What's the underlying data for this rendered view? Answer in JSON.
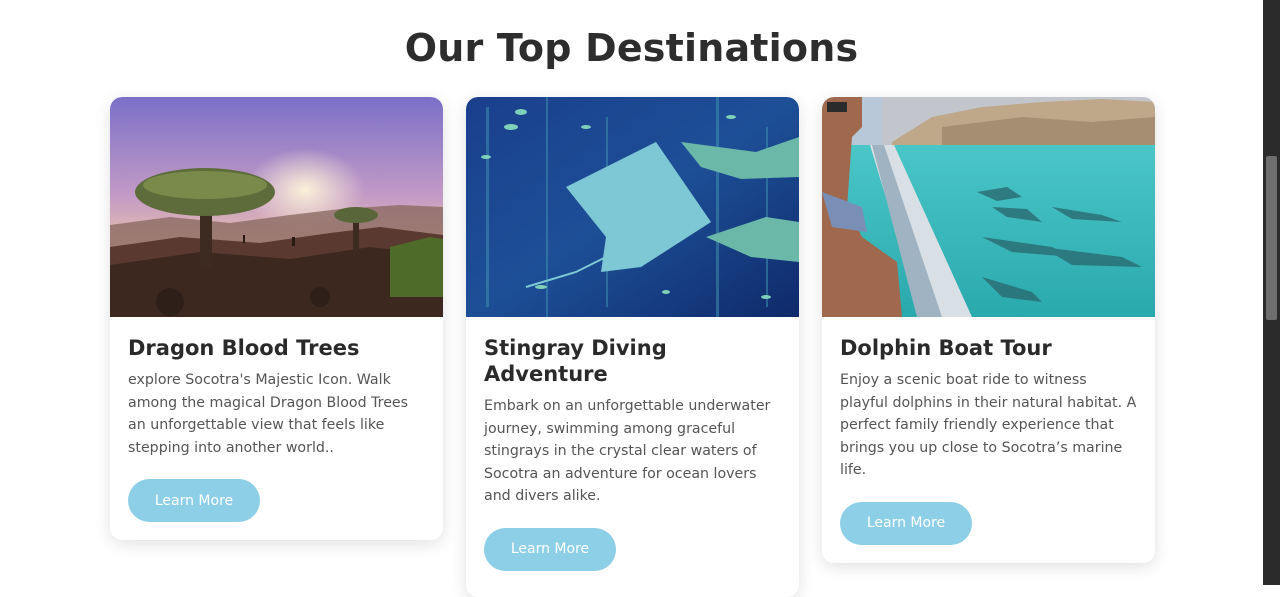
{
  "section": {
    "title": "Our Top Destinations"
  },
  "cards": [
    {
      "title": "Dragon Blood Trees",
      "description": "explore Socotra's Majestic Icon. Walk among the magical Dragon Blood Trees an unforgettable view that feels like stepping into another world..",
      "button_label": "Learn More",
      "image": "dragon-blood-trees-photo"
    },
    {
      "title": "Stingray Diving Adventure",
      "description": "Embark on an unforgettable underwater journey, swimming among graceful stingrays in the crystal clear waters of Socotra an adventure for ocean lovers and divers alike.",
      "button_label": "Learn More",
      "image": "stingray-diving-photo"
    },
    {
      "title": "Dolphin Boat Tour",
      "description": "Enjoy a scenic boat ride to witness playful dolphins in their natural habitat. A perfect family friendly experience that brings you up close to Socotra’s marine life.",
      "button_label": "Learn More",
      "image": "dolphin-boat-photo"
    }
  ],
  "colors": {
    "button": "#8ecfe8",
    "title": "#2a2a2a",
    "text": "#555555",
    "scrollbar_track": "#2b2b2b",
    "scrollbar_thumb": "#6e6e6e"
  }
}
